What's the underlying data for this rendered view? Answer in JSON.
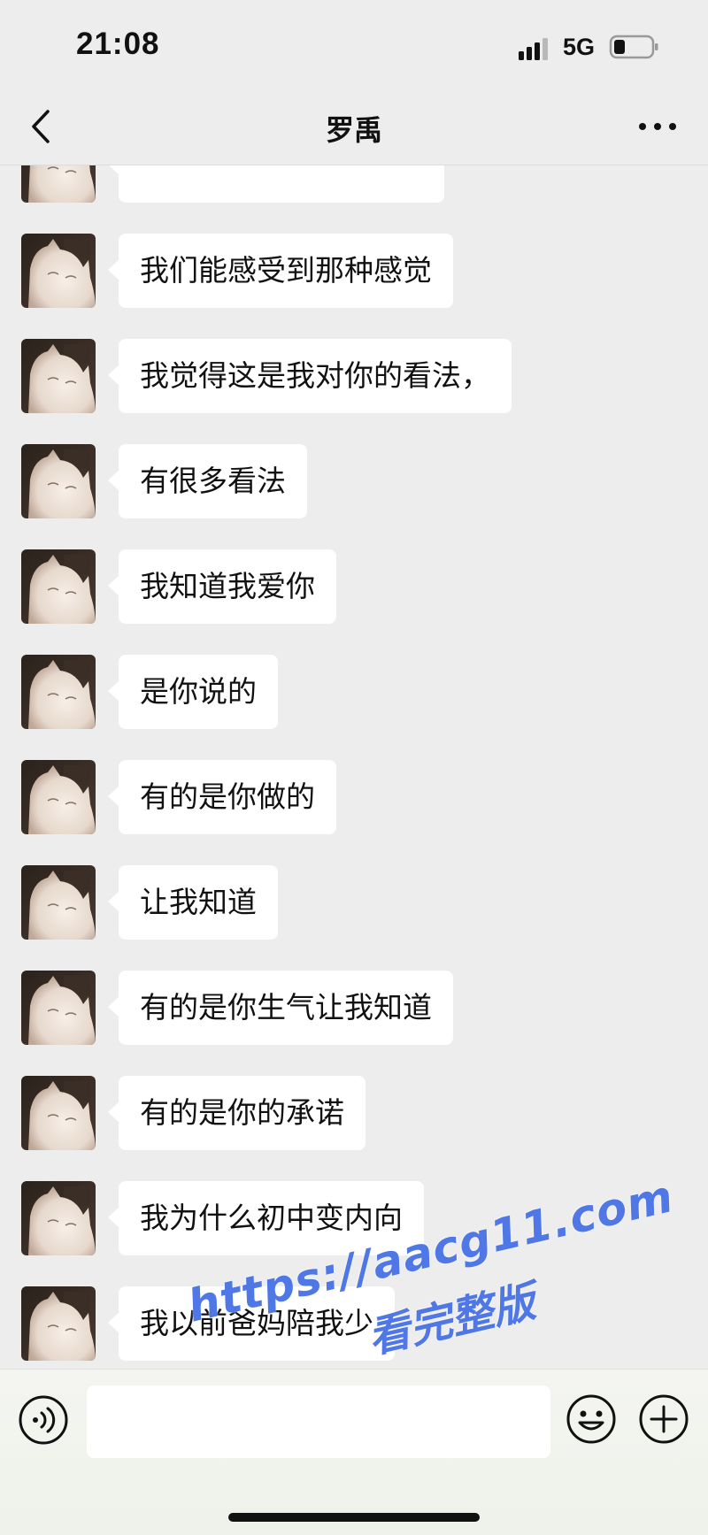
{
  "status_bar": {
    "time": "21:08",
    "network": "5G",
    "signal_icon": "signal-bars-icon",
    "battery_icon": "battery-icon"
  },
  "header": {
    "title": "罗禹",
    "back_icon": "chevron-left-icon",
    "more_icon": "more-dots-icon"
  },
  "messages": [
    {
      "sender": "other",
      "text": ""
    },
    {
      "sender": "other",
      "text": "我们能感受到那种感觉"
    },
    {
      "sender": "other",
      "text": "我觉得这是我对你的看法，"
    },
    {
      "sender": "other",
      "text": "有很多看法"
    },
    {
      "sender": "other",
      "text": "我知道我爱你"
    },
    {
      "sender": "other",
      "text": "是你说的"
    },
    {
      "sender": "other",
      "text": "有的是你做的"
    },
    {
      "sender": "other",
      "text": "让我知道"
    },
    {
      "sender": "other",
      "text": "有的是你生气让我知道"
    },
    {
      "sender": "other",
      "text": "有的是你的承诺"
    },
    {
      "sender": "other",
      "text": "我为什么初中变内向"
    },
    {
      "sender": "other",
      "text": "我以前爸妈陪我少"
    }
  ],
  "input_bar": {
    "value": "",
    "voice_icon": "voice-icon",
    "emoji_icon": "emoji-icon",
    "plus_icon": "plus-icon"
  },
  "watermark": {
    "url": "https://aacg11.com",
    "subtitle": "看完整版"
  },
  "colors": {
    "background": "#ededed",
    "bubble": "#ffffff",
    "watermark": "#4f78e6"
  }
}
